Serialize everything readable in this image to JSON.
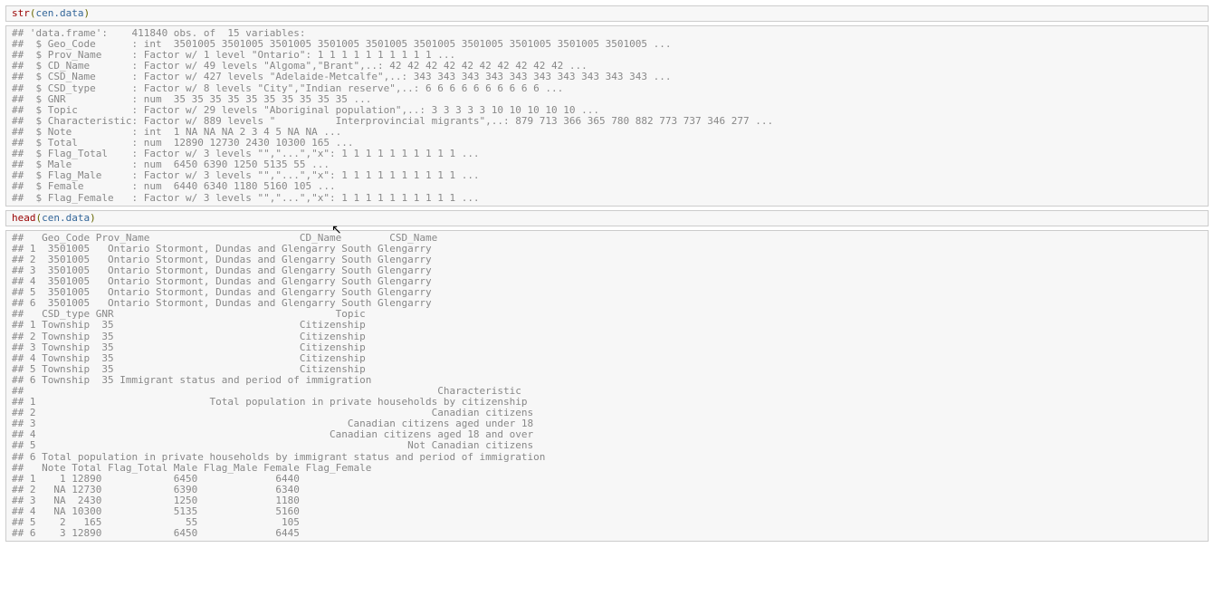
{
  "code1": {
    "fn": "str",
    "open": "(",
    "arg": "cen.data",
    "close": ")"
  },
  "out1_lines": [
    "## 'data.frame':    411840 obs. of  15 variables:",
    "##  $ Geo_Code      : int  3501005 3501005 3501005 3501005 3501005 3501005 3501005 3501005 3501005 3501005 ...",
    "##  $ Prov_Name     : Factor w/ 1 level \"Ontario\": 1 1 1 1 1 1 1 1 1 1 ...",
    "##  $ CD_Name       : Factor w/ 49 levels \"Algoma\",\"Brant\",..: 42 42 42 42 42 42 42 42 42 42 ...",
    "##  $ CSD_Name      : Factor w/ 427 levels \"Adelaide-Metcalfe\",..: 343 343 343 343 343 343 343 343 343 343 ...",
    "##  $ CSD_type      : Factor w/ 8 levels \"City\",\"Indian reserve\",..: 6 6 6 6 6 6 6 6 6 6 ...",
    "##  $ GNR           : num  35 35 35 35 35 35 35 35 35 35 ...",
    "##  $ Topic         : Factor w/ 29 levels \"Aboriginal population\",..: 3 3 3 3 3 10 10 10 10 10 ...",
    "##  $ Characteristic: Factor w/ 889 levels \"          Interprovincial migrants\",..: 879 713 366 365 780 882 773 737 346 277 ...",
    "##  $ Note          : int  1 NA NA NA 2 3 4 5 NA NA ...",
    "##  $ Total         : num  12890 12730 2430 10300 165 ...",
    "##  $ Flag_Total    : Factor w/ 3 levels \"\",\"...\",\"x\": 1 1 1 1 1 1 1 1 1 1 ...",
    "##  $ Male          : num  6450 6390 1250 5135 55 ...",
    "##  $ Flag_Male     : Factor w/ 3 levels \"\",\"...\",\"x\": 1 1 1 1 1 1 1 1 1 1 ...",
    "##  $ Female        : num  6440 6340 1180 5160 105 ...",
    "##  $ Flag_Female   : Factor w/ 3 levels \"\",\"...\",\"x\": 1 1 1 1 1 1 1 1 1 1 ..."
  ],
  "code2": {
    "fn": "head",
    "open": "(",
    "arg": "cen.data",
    "close": ")"
  },
  "out2_lines": [
    "##   Geo_Code Prov_Name                         CD_Name        CSD_Name",
    "## 1  3501005   Ontario Stormont, Dundas and Glengarry South Glengarry",
    "## 2  3501005   Ontario Stormont, Dundas and Glengarry South Glengarry",
    "## 3  3501005   Ontario Stormont, Dundas and Glengarry South Glengarry",
    "## 4  3501005   Ontario Stormont, Dundas and Glengarry South Glengarry",
    "## 5  3501005   Ontario Stormont, Dundas and Glengarry South Glengarry",
    "## 6  3501005   Ontario Stormont, Dundas and Glengarry South Glengarry",
    "##   CSD_type GNR                                     Topic",
    "## 1 Township  35                               Citizenship",
    "## 2 Township  35                               Citizenship",
    "## 3 Township  35                               Citizenship",
    "## 4 Township  35                               Citizenship",
    "## 5 Township  35                               Citizenship",
    "## 6 Township  35 Immigrant status and period of immigration",
    "##                                                                     Characteristic",
    "## 1                             Total population in private households by citizenship",
    "## 2                                                                  Canadian citizens",
    "## 3                                                    Canadian citizens aged under 18",
    "## 4                                                 Canadian citizens aged 18 and over",
    "## 5                                                              Not Canadian citizens",
    "## 6 Total population in private households by immigrant status and period of immigration",
    "##   Note Total Flag_Total Male Flag_Male Female Flag_Female",
    "## 1    1 12890            6450             6440            ",
    "## 2   NA 12730            6390             6340            ",
    "## 3   NA  2430            1250             1180            ",
    "## 4   NA 10300            5135             5160            ",
    "## 5    2   165              55              105            ",
    "## 6    3 12890            6450             6445            "
  ]
}
